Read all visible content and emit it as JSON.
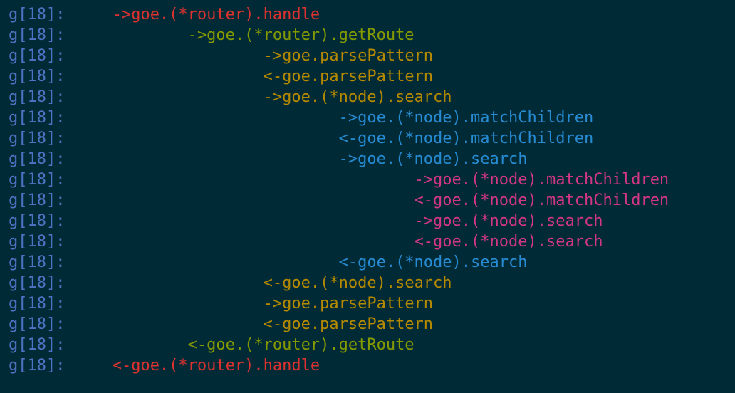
{
  "trace": {
    "lines": [
      {
        "prefix": "g[18]:",
        "indent": "     ",
        "text": "->goe.(*router).handle",
        "depth": 1
      },
      {
        "prefix": "g[18]:",
        "indent": "             ",
        "text": "->goe.(*router).getRoute",
        "depth": 2
      },
      {
        "prefix": "g[18]:",
        "indent": "                     ",
        "text": "->goe.parsePattern",
        "depth": 3
      },
      {
        "prefix": "g[18]:",
        "indent": "                     ",
        "text": "<-goe.parsePattern",
        "depth": 3
      },
      {
        "prefix": "g[18]:",
        "indent": "                     ",
        "text": "->goe.(*node).search",
        "depth": 3
      },
      {
        "prefix": "g[18]:",
        "indent": "                             ",
        "text": "->goe.(*node).matchChildren",
        "depth": 4
      },
      {
        "prefix": "g[18]:",
        "indent": "                             ",
        "text": "<-goe.(*node).matchChildren",
        "depth": 4
      },
      {
        "prefix": "g[18]:",
        "indent": "                             ",
        "text": "->goe.(*node).search",
        "depth": 4
      },
      {
        "prefix": "g[18]:",
        "indent": "                                     ",
        "text": "->goe.(*node).matchChildren",
        "depth": 5
      },
      {
        "prefix": "g[18]:",
        "indent": "                                     ",
        "text": "<-goe.(*node).matchChildren",
        "depth": 5
      },
      {
        "prefix": "g[18]:",
        "indent": "                                     ",
        "text": "->goe.(*node).search",
        "depth": 5
      },
      {
        "prefix": "g[18]:",
        "indent": "                                     ",
        "text": "<-goe.(*node).search",
        "depth": 5
      },
      {
        "prefix": "g[18]:",
        "indent": "                             ",
        "text": "<-goe.(*node).search",
        "depth": 4
      },
      {
        "prefix": "g[18]:",
        "indent": "                     ",
        "text": "<-goe.(*node).search",
        "depth": 3
      },
      {
        "prefix": "g[18]:",
        "indent": "                     ",
        "text": "->goe.parsePattern",
        "depth": 3
      },
      {
        "prefix": "g[18]:",
        "indent": "                     ",
        "text": "<-goe.parsePattern",
        "depth": 3
      },
      {
        "prefix": "g[18]:",
        "indent": "             ",
        "text": "<-goe.(*router).getRoute",
        "depth": 2
      },
      {
        "prefix": "g[18]:",
        "indent": "     ",
        "text": "<-goe.(*router).handle",
        "depth": 1
      }
    ]
  },
  "colors": {
    "background": "#002b36",
    "prefix": "#4f73c4",
    "depth1": "#dc322f",
    "depth2": "#859900",
    "depth3": "#b58900",
    "depth4": "#268bd2",
    "depth5": "#d33682"
  }
}
